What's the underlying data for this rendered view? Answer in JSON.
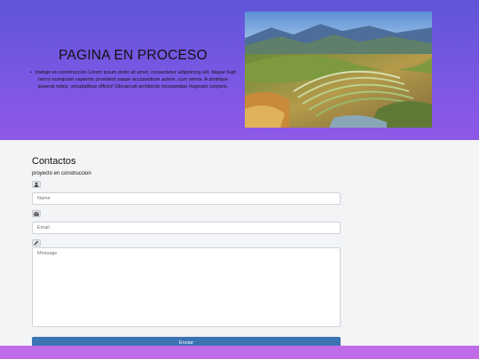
{
  "hero": {
    "title": "PAGINA EN PROCESO",
    "paragraph": "trabajo en construccion Lorem ipsum dolor sit amet, consectetur adipisicing elit. Itaque fugit nemo numquam sapiente provident saepe accusantium autem, cum omnis. A similique quaerat nobis, voluptatibus officiis! Obcaecati architecto recusandae magnam corporis."
  },
  "contact": {
    "title": "Contactos",
    "subtitle": "proyecto en construccion",
    "name_placeholder": "Name",
    "email_placeholder": "Email",
    "message_placeholder": "Message",
    "send_label": "Enviar"
  },
  "icons": {
    "name": "user-icon",
    "email": "envelope-icon",
    "message": "pencil-icon"
  },
  "colors": {
    "hero_top": "#5f55d9",
    "hero_bottom": "#8e58e6",
    "button": "#3b73b3",
    "footer": "#c06ce8"
  }
}
